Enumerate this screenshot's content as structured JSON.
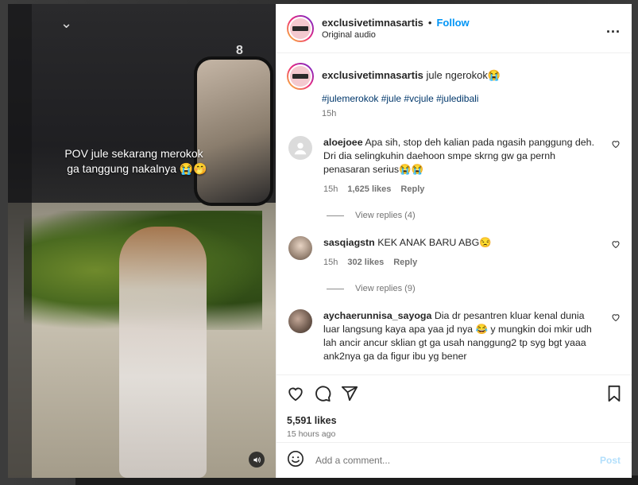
{
  "video": {
    "overlay_line1": "POV jule sekarang merokok",
    "overlay_line2": "ga tanggung nakalnya 😭🤭",
    "corner_mark": "8",
    "chevron": "⌄"
  },
  "header": {
    "username": "exclusivetimnasartis",
    "separator": "•",
    "follow_label": "Follow",
    "subtitle": "Original audio",
    "more_label": "..."
  },
  "caption": {
    "username": "exclusivetimnasartis",
    "text": "jule ngerokok😭",
    "hashtags": "#julemerokok #jule #vcjule #juledibali",
    "time": "15h"
  },
  "comments": [
    {
      "username": "aloejoee",
      "text": "Apa sih, stop deh kalian pada ngasih panggung deh. Dri dia selingkuhin daehoon smpe skrng gw ga pernh penasaran serius😭😭",
      "time": "15h",
      "likes": "1,625 likes",
      "reply": "Reply",
      "view_replies": "View replies (4)",
      "avatar_color": "#c7c7c7"
    },
    {
      "username": "sasqiagstn",
      "text": "KEK ANAK BARU ABG😒",
      "time": "15h",
      "likes": "302 likes",
      "reply": "Reply",
      "view_replies": "View replies (9)",
      "avatar_color": "#9c8878"
    },
    {
      "username": "aychaerunnisa_sayoga",
      "text": "Dia dr pesantren kluar kenal dunia luar langsung kaya apa yaa jd nya 😂 y mungkin doi mkir udh lah ancir ancur sklian gt ga usah nanggung2 tp syg bgt yaaa ank2nya ga da figur ibu yg bener",
      "avatar_color": "#6e5a4e"
    }
  ],
  "actions": {
    "likes": "5,591 likes",
    "ago": "15 hours ago"
  },
  "add_comment": {
    "placeholder": "Add a comment...",
    "post_label": "Post"
  }
}
